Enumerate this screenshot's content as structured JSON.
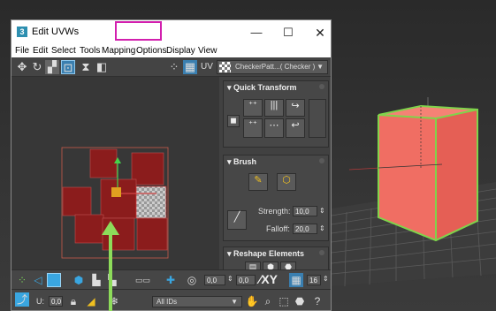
{
  "window": {
    "title": "Edit UVWs",
    "app_icon_label": "3",
    "controls": {
      "minimize": "—",
      "maximize": "☐",
      "close": "✕"
    }
  },
  "menu": {
    "items": [
      "File",
      "Edit",
      "Select",
      "Tools",
      "Mapping",
      "Options",
      "Display",
      "View"
    ]
  },
  "toolbar": {
    "uv_label": "UV",
    "checker_map": "CheckerPatt...( Checker )",
    "dropdown_arrow": "▼"
  },
  "rollouts": {
    "quick_transform": {
      "title": "Quick Transform"
    },
    "brush": {
      "title": "Brush",
      "strength_label": "Strength:",
      "strength_value": "10,0",
      "falloff_label": "Falloff:",
      "falloff_value": "20,0"
    },
    "reshape_elements": {
      "title": "Reshape Elements"
    }
  },
  "bottom_toolbar": {
    "rotate_value": "0,0",
    "angle_value": "0,0",
    "xy_label": "XY",
    "grid_value": "16",
    "u_label": "U:",
    "u_value": "0,0",
    "id_filter": "All IDs"
  },
  "colors": {
    "uv_shell_fill": "#8b1c1c",
    "highlight_box": "#d21fae",
    "arrow": "#8ddc5a",
    "cube_fill": "#f06e63",
    "cube_edges": "#7fd44b",
    "accent_blue": "#3aa6e0"
  }
}
